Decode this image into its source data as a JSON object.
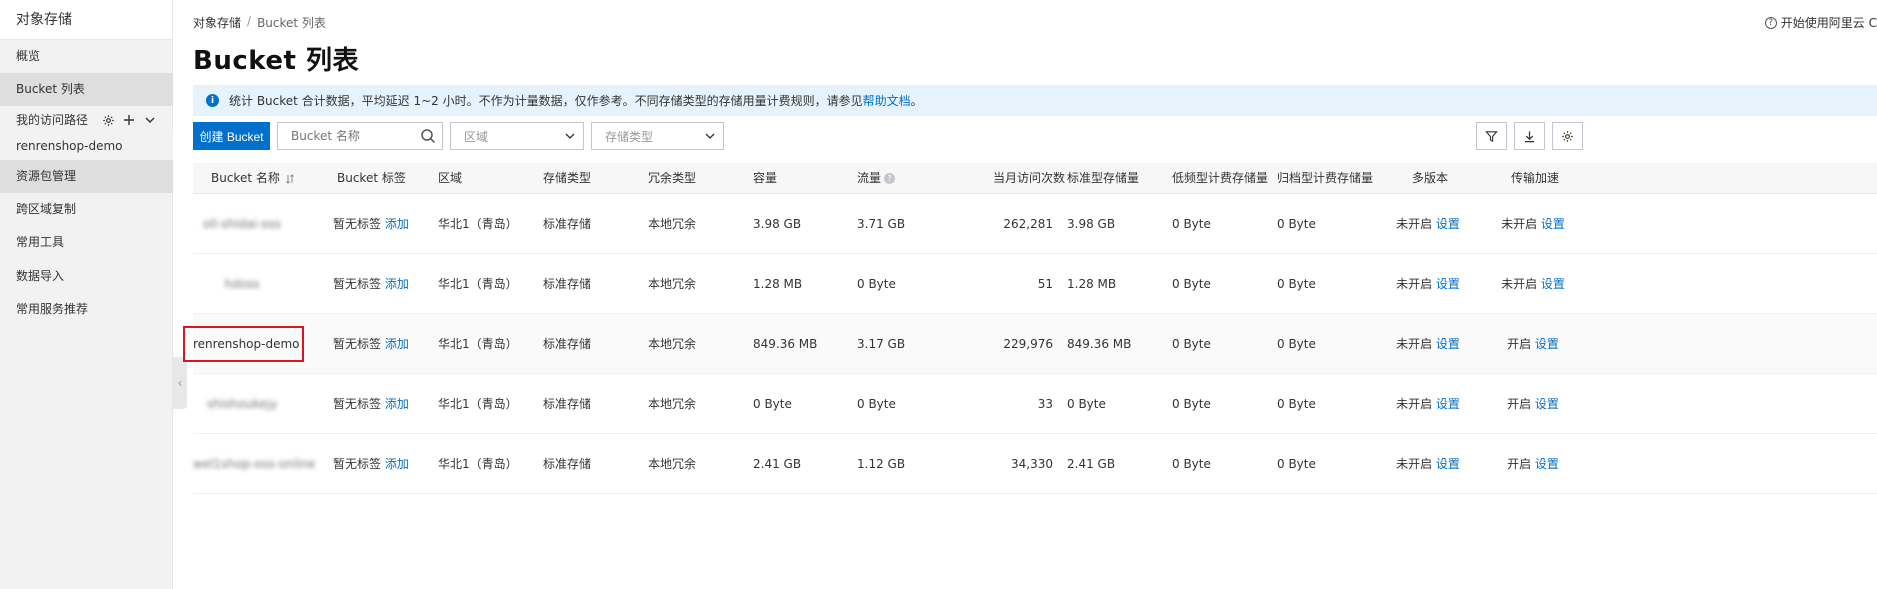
{
  "sidebar": {
    "title": "对象存储",
    "items": [
      {
        "label": "概览"
      },
      {
        "label": "Bucket 列表"
      },
      {
        "label": "我的访问路径"
      },
      {
        "label": "renrenshop-demo"
      },
      {
        "label": "资源包管理"
      },
      {
        "label": "跨区域复制"
      },
      {
        "label": "常用工具"
      },
      {
        "label": "数据导入"
      },
      {
        "label": "常用服务推荐"
      }
    ]
  },
  "header": {
    "breadcrumb": [
      "对象存储",
      "Bucket 列表"
    ],
    "breadcrumb_sep": "/",
    "top_right": "开始使用阿里云 C",
    "title": "Bucket 列表"
  },
  "notice": {
    "text": "统计 Bucket 合计数据，平均延迟 1~2 小时。不作为计量数据，仅作参考。不同存储类型的存储用量计费规则，请参见",
    "link": "帮助文档",
    "suffix": "。"
  },
  "toolbar": {
    "create_label": "创建 Bucket",
    "search_placeholder": "Bucket 名称",
    "region_placeholder": "区域",
    "storage_placeholder": "存储类型"
  },
  "table": {
    "columns": [
      "Bucket 名称",
      "Bucket 标签",
      "区域",
      "存储类型",
      "冗余类型",
      "容量",
      "流量",
      "当月访问次数",
      "标准型存储量",
      "低频型计费存储量",
      "归档型计费存储量",
      "多版本",
      "传输加速"
    ],
    "rows": [
      {
        "name": "oll-shidai-oss",
        "tag": "暂无标签",
        "tag_action": "添加",
        "region": "华北1（青岛）",
        "storage": "标准存储",
        "redundancy": "本地冗余",
        "capacity": "3.98 GB",
        "traffic": "3.71 GB",
        "visits": "262,281",
        "standard": "3.98 GB",
        "ia": "0 Byte",
        "archive": "0 Byte",
        "versioning": "未开启",
        "versioning_action": "设置",
        "accel": "未开启",
        "accel_action": "设置"
      },
      {
        "name": "hdoss",
        "tag": "暂无标签",
        "tag_action": "添加",
        "region": "华北1（青岛）",
        "storage": "标准存储",
        "redundancy": "本地冗余",
        "capacity": "1.28 MB",
        "traffic": "0 Byte",
        "visits": "51",
        "standard": "1.28 MB",
        "ia": "0 Byte",
        "archive": "0 Byte",
        "versioning": "未开启",
        "versioning_action": "设置",
        "accel": "未开启",
        "accel_action": "设置"
      },
      {
        "name": "renrenshop-demo",
        "tag": "暂无标签",
        "tag_action": "添加",
        "region": "华北1（青岛）",
        "storage": "标准存储",
        "redundancy": "本地冗余",
        "capacity": "849.36 MB",
        "traffic": "3.17 GB",
        "visits": "229,976",
        "standard": "849.36 MB",
        "ia": "0 Byte",
        "archive": "0 Byte",
        "versioning": "未开启",
        "versioning_action": "设置",
        "accel": "开启",
        "accel_action": "设置"
      },
      {
        "name": "shishoukejy",
        "tag": "暂无标签",
        "tag_action": "添加",
        "region": "华北1（青岛）",
        "storage": "标准存储",
        "redundancy": "本地冗余",
        "capacity": "0 Byte",
        "traffic": "0 Byte",
        "visits": "33",
        "standard": "0 Byte",
        "ia": "0 Byte",
        "archive": "0 Byte",
        "versioning": "未开启",
        "versioning_action": "设置",
        "accel": "开启",
        "accel_action": "设置"
      },
      {
        "name": "wel1shop-oss-online",
        "tag": "暂无标签",
        "tag_action": "添加",
        "region": "华北1（青岛）",
        "storage": "标准存储",
        "redundancy": "本地冗余",
        "capacity": "2.41 GB",
        "traffic": "1.12 GB",
        "visits": "34,330",
        "standard": "2.41 GB",
        "ia": "0 Byte",
        "archive": "0 Byte",
        "versioning": "未开启",
        "versioning_action": "设置",
        "accel": "开启",
        "accel_action": "设置"
      }
    ]
  },
  "colors": {
    "primary": "#0070cc",
    "highlight_border": "#d9161c",
    "notice_bg": "#e6f3fc",
    "sidebar_bg": "#f2f2f2"
  }
}
